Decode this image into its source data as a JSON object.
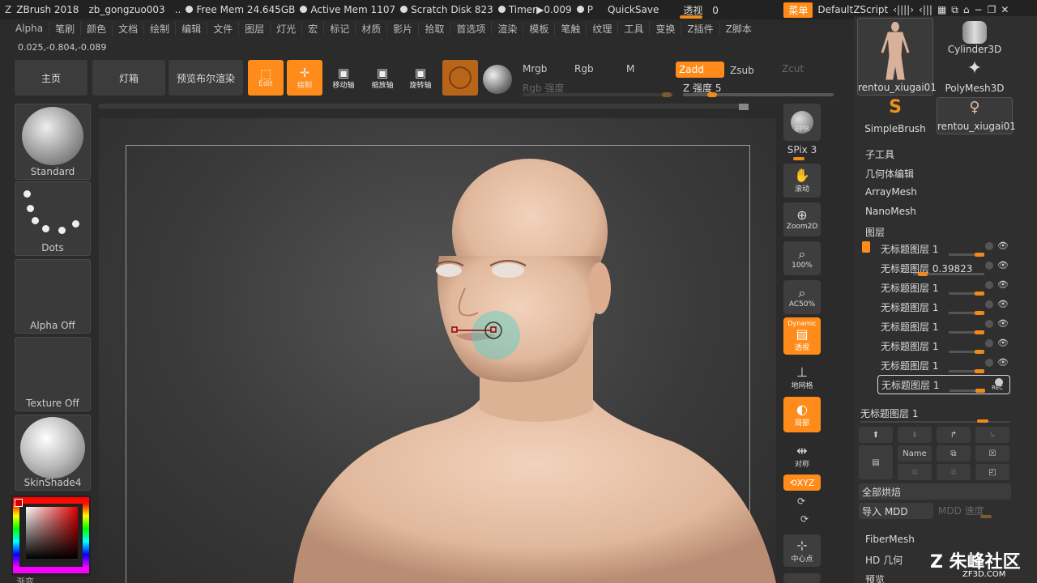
{
  "titlebar": {
    "app": "ZBrush 2018",
    "file": "zb_gongzuo003",
    "ellipsis": "..",
    "free_mem": "Free Mem 24.645GB",
    "active_mem": "Active Mem 1107",
    "scratch": "Scratch Disk 823",
    "timer": "Timer▶0.009",
    "p": "P",
    "quicksave": "QuickSave",
    "perspective": "透视",
    "perspective_value": "0",
    "menu_btn": "菜单",
    "zscript": "DefaultZScript"
  },
  "menubar": [
    "Alpha",
    "笔刷",
    "颜色",
    "文档",
    "绘制",
    "编辑",
    "文件",
    "图层",
    "灯光",
    "宏",
    "标记",
    "材质",
    "影片",
    "拾取",
    "首选项",
    "渲染",
    "模板",
    "笔触",
    "纹理",
    "工具",
    "变换",
    "Z插件",
    "Z脚本"
  ],
  "coords": "0.025,-0.804,-0.089",
  "toolbar": {
    "home": "主页",
    "lightbox": "灯箱",
    "bpr_preview": "预览布尔渲染",
    "edit": "Edit",
    "draw": "绘制",
    "move": "移动轴",
    "scale": "缩放轴",
    "rotate": "旋转轴",
    "mrgb": "Mrgb",
    "rgb": "Rgb",
    "m": "M",
    "zadd": "Zadd",
    "zsub": "Zsub",
    "zcut": "Zcut",
    "rgb_intensity": "Rgb 强度",
    "z_intensity": "Z 强度 5"
  },
  "left_shelf": {
    "brush": "Standard",
    "stroke": "Dots",
    "alpha": "Alpha Off",
    "texture": "Texture Off",
    "material": "SkinShade4",
    "gradient": "渐变"
  },
  "right_tools": {
    "bpr": "BPR",
    "spix": "SPix 3",
    "scroll": "滚动",
    "zoom2d": "Zoom2D",
    "zoom100": "100%",
    "ac50": "AC50%",
    "dynamic": "Dynamic",
    "persp": "透视",
    "floor": "地网格",
    "local": "局部",
    "sym": "对称",
    "xyz": "XYZ",
    "center": "中心点"
  },
  "subtools": [
    {
      "label": "rentou_xiugai01"
    },
    {
      "label": "Cylinder3D"
    },
    {
      "label": "PolyMesh3D"
    },
    {
      "label": "SimpleBrush"
    },
    {
      "label": "rentou_xiugai01"
    }
  ],
  "panel": {
    "subtool": "子工具",
    "geometry": "几何体编辑",
    "arraymesh": "ArrayMesh",
    "nanomesh": "NanoMesh",
    "layers": "图层",
    "fibermesh": "FiberMesh",
    "hd": "HD 几何",
    "preview": "预览"
  },
  "layers": [
    "无标题图层 1",
    "无标题图层 0.39823",
    "无标题图层 1",
    "无标题图层 1",
    "无标题图层 1",
    "无标题图层 1",
    "无标题图层 1",
    "无标题图层 1"
  ],
  "layer_controls": {
    "current": "无标题图层 1",
    "name": "Name",
    "rec": "REC",
    "bake_all": "全部烘焙",
    "import_mdd": "导入 MDD",
    "mdd_speed": "MDD 速度"
  },
  "watermark": {
    "brand": "朱峰社区",
    "url": "ZF3D.COM"
  },
  "colors": {
    "accent": "#ff8c1a",
    "bg": "#2b2b2b"
  }
}
